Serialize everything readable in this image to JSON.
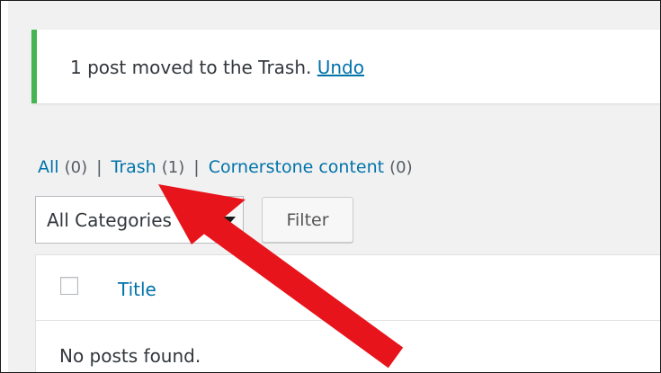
{
  "notice": {
    "message": "1 post moved to the Trash.",
    "undo_label": "Undo"
  },
  "views": {
    "all_label": "All",
    "all_count": "(0)",
    "trash_label": "Trash",
    "trash_count": "(1)",
    "cornerstone_label": "Cornerstone content",
    "cornerstone_count": "(0)",
    "separator": "|"
  },
  "filters": {
    "category_selected": "All Categories",
    "filter_label": "Filter"
  },
  "table": {
    "title_header": "Title",
    "empty_message": "No posts found."
  },
  "colors": {
    "link": "#0073aa",
    "notice_success": "#46b450",
    "arrow": "#e8141b"
  }
}
